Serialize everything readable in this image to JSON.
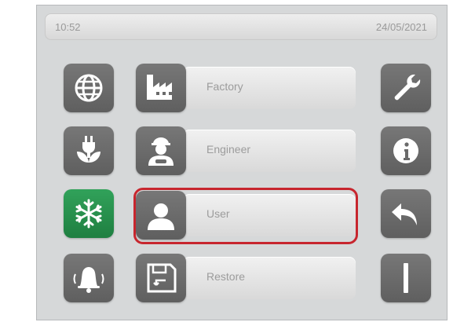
{
  "status_bar": {
    "time": "10:52",
    "date": "24/05/2021"
  },
  "menu": [
    {
      "label": "Factory",
      "icon": "factory-icon"
    },
    {
      "label": "Engineer",
      "icon": "engineer-icon"
    },
    {
      "label": "User",
      "icon": "user-icon",
      "selected": true
    },
    {
      "label": "Restore",
      "icon": "floppy-disk-icon"
    }
  ],
  "left_buttons": [
    "globe-icon",
    "plug-leaf-icon",
    "snowflake-icon",
    "bell-icon"
  ],
  "right_buttons": [
    "wrench-icon",
    "info-icon",
    "back-arrow-icon",
    "divider-bar-icon"
  ],
  "colors": {
    "accent_green": "#2a9550",
    "selection_red": "#c7262e",
    "button_gray": "#6a6a6a"
  }
}
